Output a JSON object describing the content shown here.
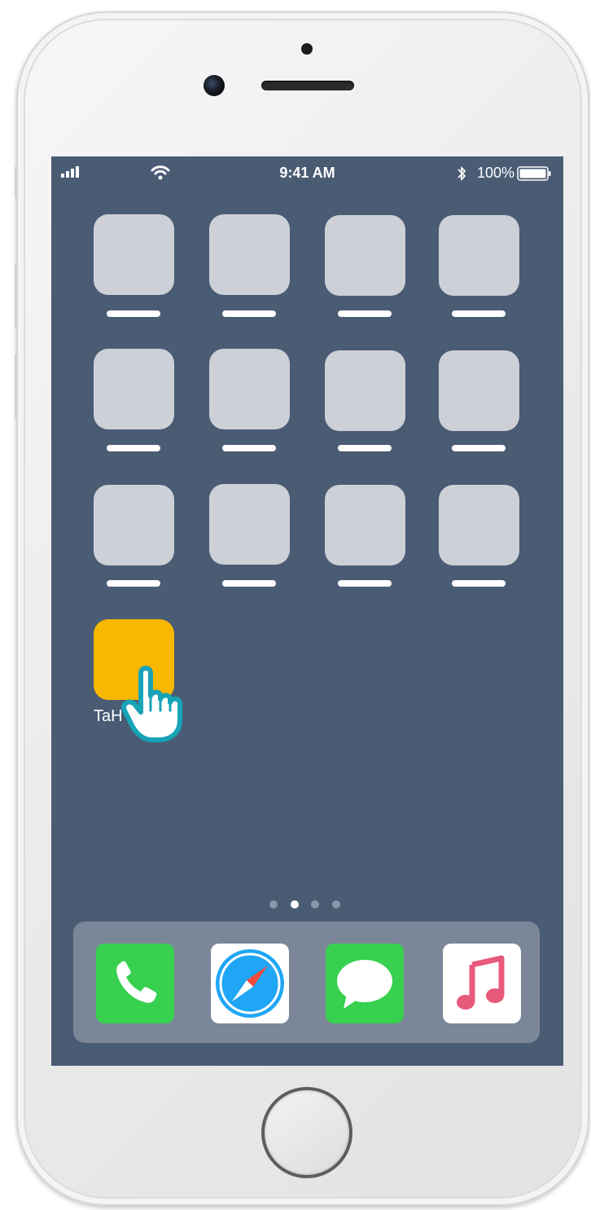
{
  "status_bar": {
    "time": "9:41 AM",
    "battery_percent": "100%"
  },
  "home_screen": {
    "app_grid": [
      {
        "placeholder": true
      },
      {
        "placeholder": true
      },
      {
        "placeholder": true
      },
      {
        "placeholder": true
      },
      {
        "placeholder": true
      },
      {
        "placeholder": true
      },
      {
        "placeholder": true
      },
      {
        "placeholder": true
      },
      {
        "placeholder": true
      },
      {
        "placeholder": true
      },
      {
        "placeholder": true
      },
      {
        "placeholder": true
      }
    ],
    "featured_app": {
      "label": "TaH",
      "color": "#f8b700"
    },
    "page_indicator": {
      "pages": 4,
      "current": 2
    }
  },
  "dock": {
    "apps": [
      {
        "icon": "phone-icon",
        "color": "#37d04f"
      },
      {
        "icon": "safari-icon",
        "color": "#1fa6f5"
      },
      {
        "icon": "messages-icon",
        "color": "#37d04f"
      },
      {
        "icon": "music-icon",
        "color": "#e85a7b"
      }
    ]
  },
  "colors": {
    "wallpaper": "#4a5b74",
    "app_placeholder": "#cdd0d7",
    "dock_background": "#7b8799",
    "pointer_outline": "#17a3b8"
  }
}
